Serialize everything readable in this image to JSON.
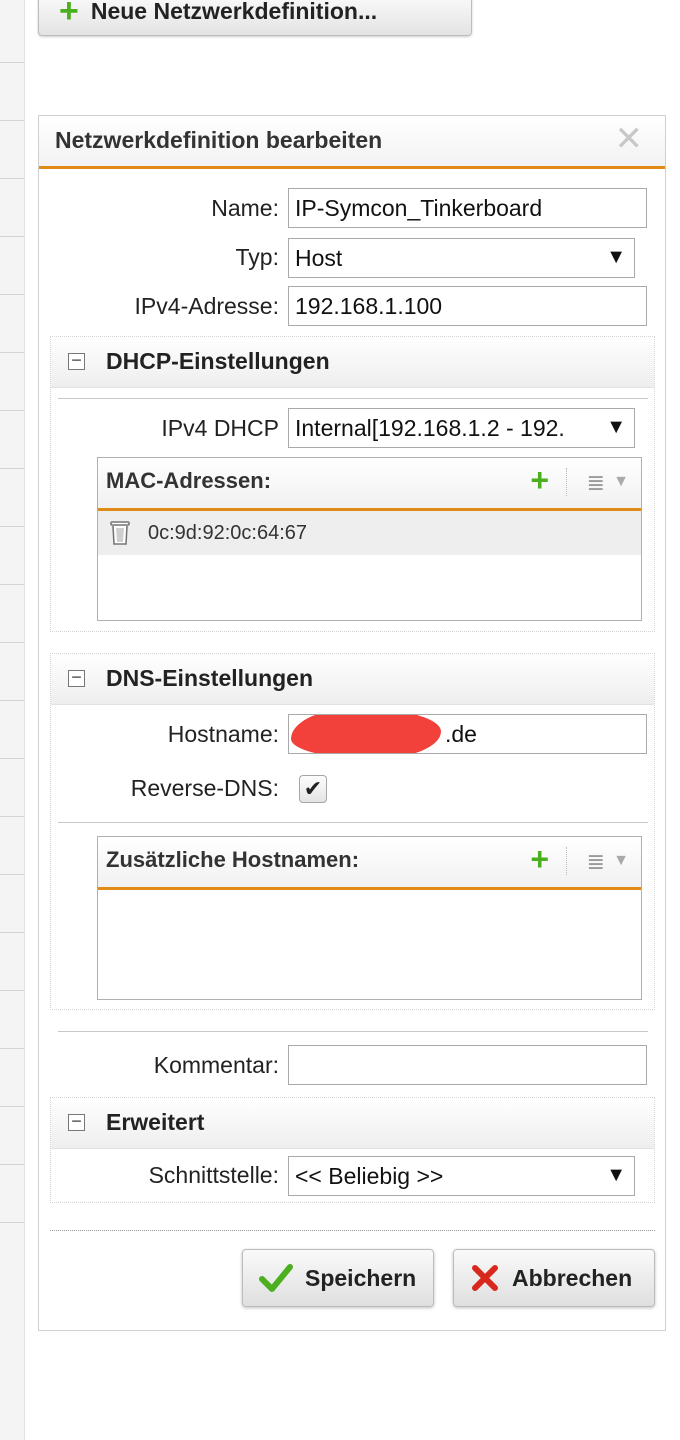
{
  "top_button": {
    "label": "Neue Netzwerkdefinition..."
  },
  "dialog": {
    "title": "Netzwerkdefinition bearbeiten",
    "name_label": "Name:",
    "name_value": "IP-Symcon_Tinkerboard",
    "type_label": "Typ:",
    "type_value": "Host",
    "ipv4_label": "IPv4-Adresse:",
    "ipv4_value": "192.168.1.100",
    "dhcp": {
      "title": "DHCP-Einstellungen",
      "ipv4_dhcp_label": "IPv4 DHCP",
      "ipv4_dhcp_value": "Internal[192.168.1.2 - 192.",
      "mac_grid_title": "MAC-Adressen:",
      "mac_addresses": [
        "0c:9d:92:0c:64:67"
      ]
    },
    "dns": {
      "title": "DNS-Einstellungen",
      "hostname_label": "Hostname:",
      "hostname_value": ".de",
      "reverse_dns_label": "Reverse-DNS:",
      "reverse_dns_checked": true,
      "extra_hostnames_title": "Zusätzliche Hostnamen:"
    },
    "comment_label": "Kommentar:",
    "comment_value": "",
    "advanced": {
      "title": "Erweitert",
      "interface_label": "Schnittstelle:",
      "interface_value": "<< Beliebig >>"
    },
    "save_label": "Speichern",
    "cancel_label": "Abbrechen"
  },
  "colors": {
    "accent": "#e08a18",
    "plus_green": "#4caf1f",
    "cancel_red": "#d8281e",
    "redaction": "#f2403a"
  }
}
